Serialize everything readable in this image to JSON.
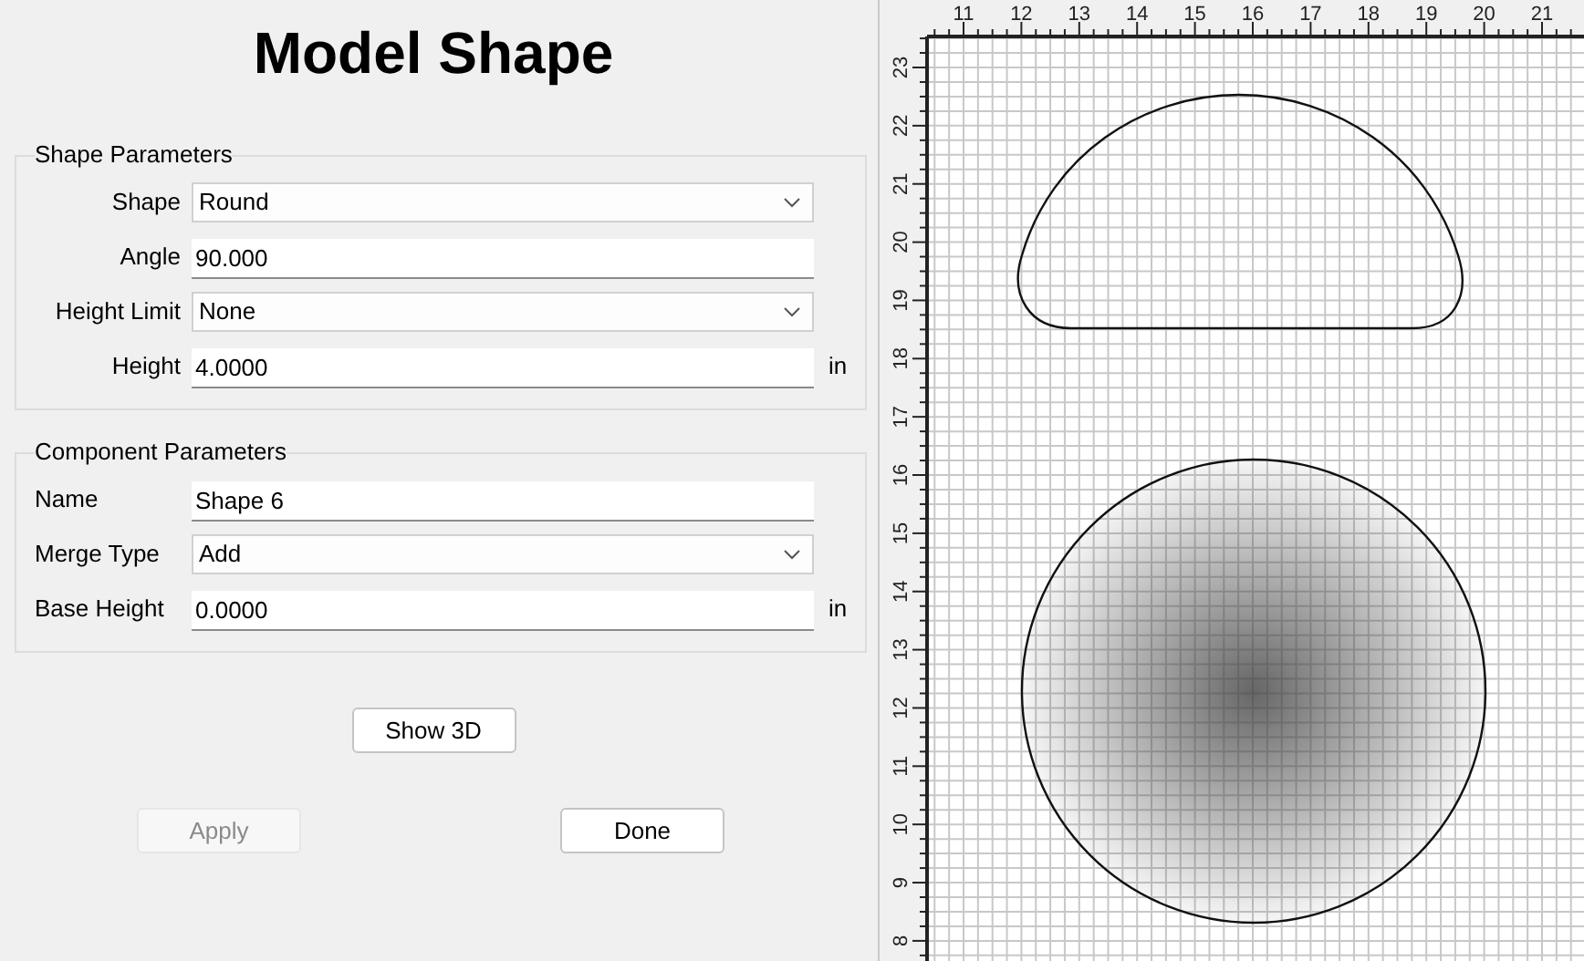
{
  "title": "Model Shape",
  "groups": [
    {
      "title": "Shape Parameters",
      "kind": "right-labels",
      "rows": [
        {
          "kind": "dropdown",
          "label": "Shape",
          "value": "Round"
        },
        {
          "kind": "text",
          "label": "Angle",
          "value": "90.000"
        },
        {
          "kind": "dropdown",
          "label": "Height Limit",
          "value": "None"
        },
        {
          "kind": "text",
          "label": "Height",
          "value": "4.0000",
          "unit": "in"
        }
      ]
    },
    {
      "title": "Component Parameters",
      "kind": "left-labels",
      "rows": [
        {
          "kind": "text",
          "label": "Name",
          "value": "Shape 6"
        },
        {
          "kind": "dropdown",
          "label": "Merge Type",
          "value": "Add"
        },
        {
          "kind": "text",
          "label": "Base Height",
          "value": "0.0000",
          "unit": "in"
        }
      ]
    }
  ],
  "show_3d_button": {
    "label": "Show 3D",
    "disabled": false
  },
  "buttons": [
    {
      "label": "Apply",
      "disabled": true
    },
    {
      "label": "Done",
      "disabled": false
    }
  ],
  "canvas": {
    "x_ruler": [
      "11",
      "12",
      "13",
      "14",
      "15",
      "16",
      "17",
      "18",
      "19",
      "20",
      "21"
    ],
    "y_ruler": [
      "23",
      "22",
      "21",
      "20",
      "19",
      "18",
      "17",
      "16",
      "15",
      "14",
      "13",
      "12",
      "11",
      "10",
      "9",
      "8"
    ]
  }
}
